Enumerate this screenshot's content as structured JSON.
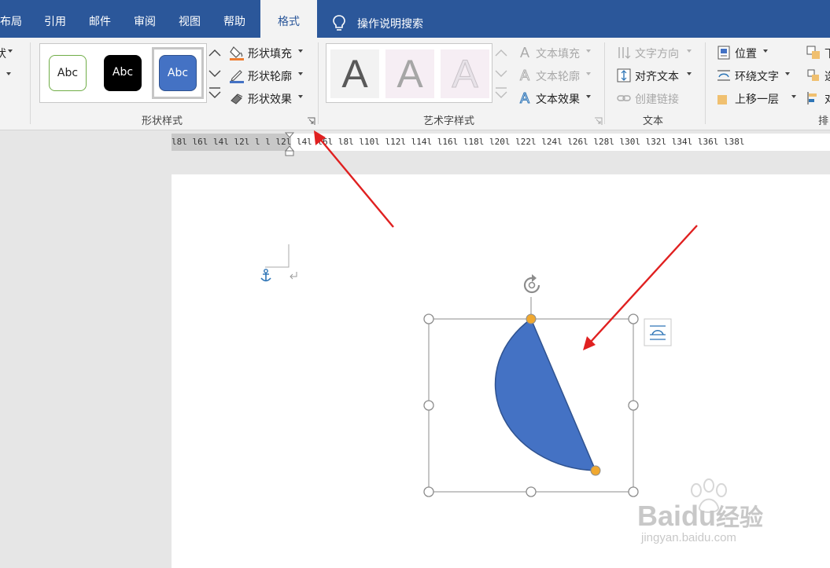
{
  "tabs": [
    {
      "label": "布局"
    },
    {
      "label": "引用"
    },
    {
      "label": "邮件"
    },
    {
      "label": "审阅"
    },
    {
      "label": "视图"
    },
    {
      "label": "帮助"
    },
    {
      "label": "格式"
    }
  ],
  "tell_me": {
    "label": "操作说明搜索"
  },
  "ribbon": {
    "partial_left": {
      "item1": "状",
      "item2": ""
    },
    "shape_styles": {
      "label": "形状样式",
      "swatches": [
        {
          "label": "Abc",
          "style": "outline-green"
        },
        {
          "label": "Abc",
          "style": "black"
        },
        {
          "label": "Abc",
          "style": "blue-selected"
        }
      ],
      "fill": "形状填充",
      "outline": "形状轮廓",
      "effects": "形状效果"
    },
    "wordart_styles": {
      "label": "艺术字样式",
      "letters": [
        "A",
        "A",
        "A"
      ],
      "text_fill": "文本填充",
      "text_outline": "文本轮廓",
      "text_effects": "文本效果"
    },
    "text_group": {
      "label": "文本",
      "direction": "文字方向",
      "align": "对齐文本",
      "link": "创建链接"
    },
    "arrange_group": {
      "label": "排",
      "position": "位置",
      "wrap": "环绕文字",
      "bring_forward": "上移一层",
      "send_back": "下",
      "selection": "选",
      "align": "对"
    }
  },
  "ruler": {
    "ticks": "l8l  l6l  l4l  l2l  l  l  l2l  l4l  l6l  l8l  l10l  l12l  l14l  l16l  l18l  l20l  l22l  l24l  l26l  l28l  l30l  l32l  l34l  l36l  l38l"
  },
  "shape": {
    "fill": "#4472c4",
    "stroke": "#2f528f",
    "handle_color": "#f0a830",
    "type": "chord"
  },
  "colors": {
    "brand": "#2b579a",
    "arrow": "#e02020"
  },
  "watermark": {
    "brand": "Baidu",
    "sub": "经验",
    "url": "jingyan.baidu.com"
  }
}
